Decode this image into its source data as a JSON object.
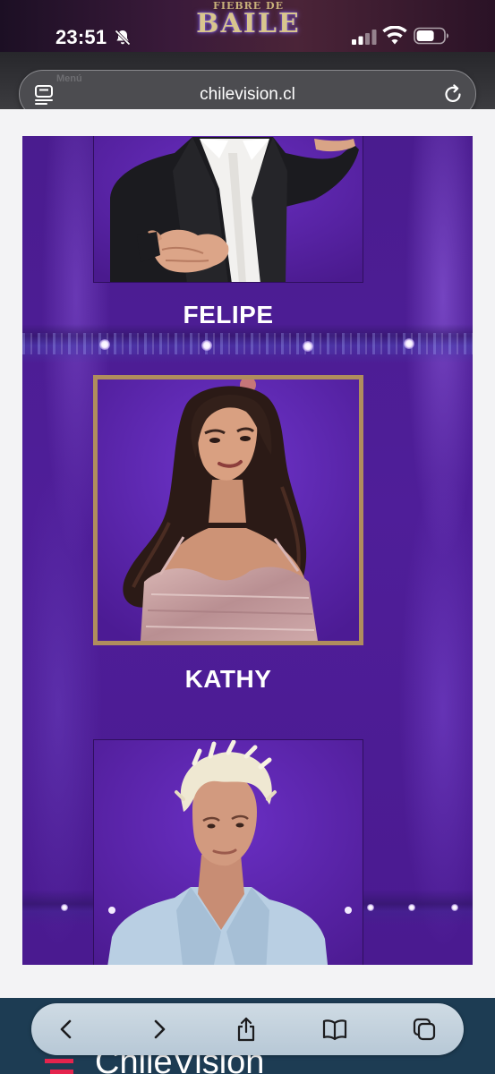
{
  "status_bar": {
    "time": "23:51",
    "show_logo": {
      "small": "FIEBRE DE",
      "big": "BAILE"
    },
    "icons": [
      "bell-slash-icon",
      "cellular-signal-icon",
      "wifi-icon",
      "battery-icon"
    ]
  },
  "browser": {
    "url": "chilevision.cl",
    "ghost_text": "Menú",
    "icons": [
      "reader-mode-icon",
      "reload-icon"
    ]
  },
  "participants": [
    {
      "name": "FELIPE",
      "selected": false
    },
    {
      "name": "KATHY",
      "selected": true
    },
    {
      "name": "",
      "selected": false
    }
  ],
  "colors": {
    "background_purple": "#4f1e99",
    "featured_border": "#b08d5d",
    "name_text": "#ffffff",
    "toolbar_bg": "#1d3c53"
  },
  "toolbar": {
    "buttons": [
      "back-icon",
      "forward-icon",
      "share-icon",
      "bookmarks-icon",
      "tabs-icon"
    ]
  },
  "footer_brand": {
    "word": "ChileVisión"
  }
}
